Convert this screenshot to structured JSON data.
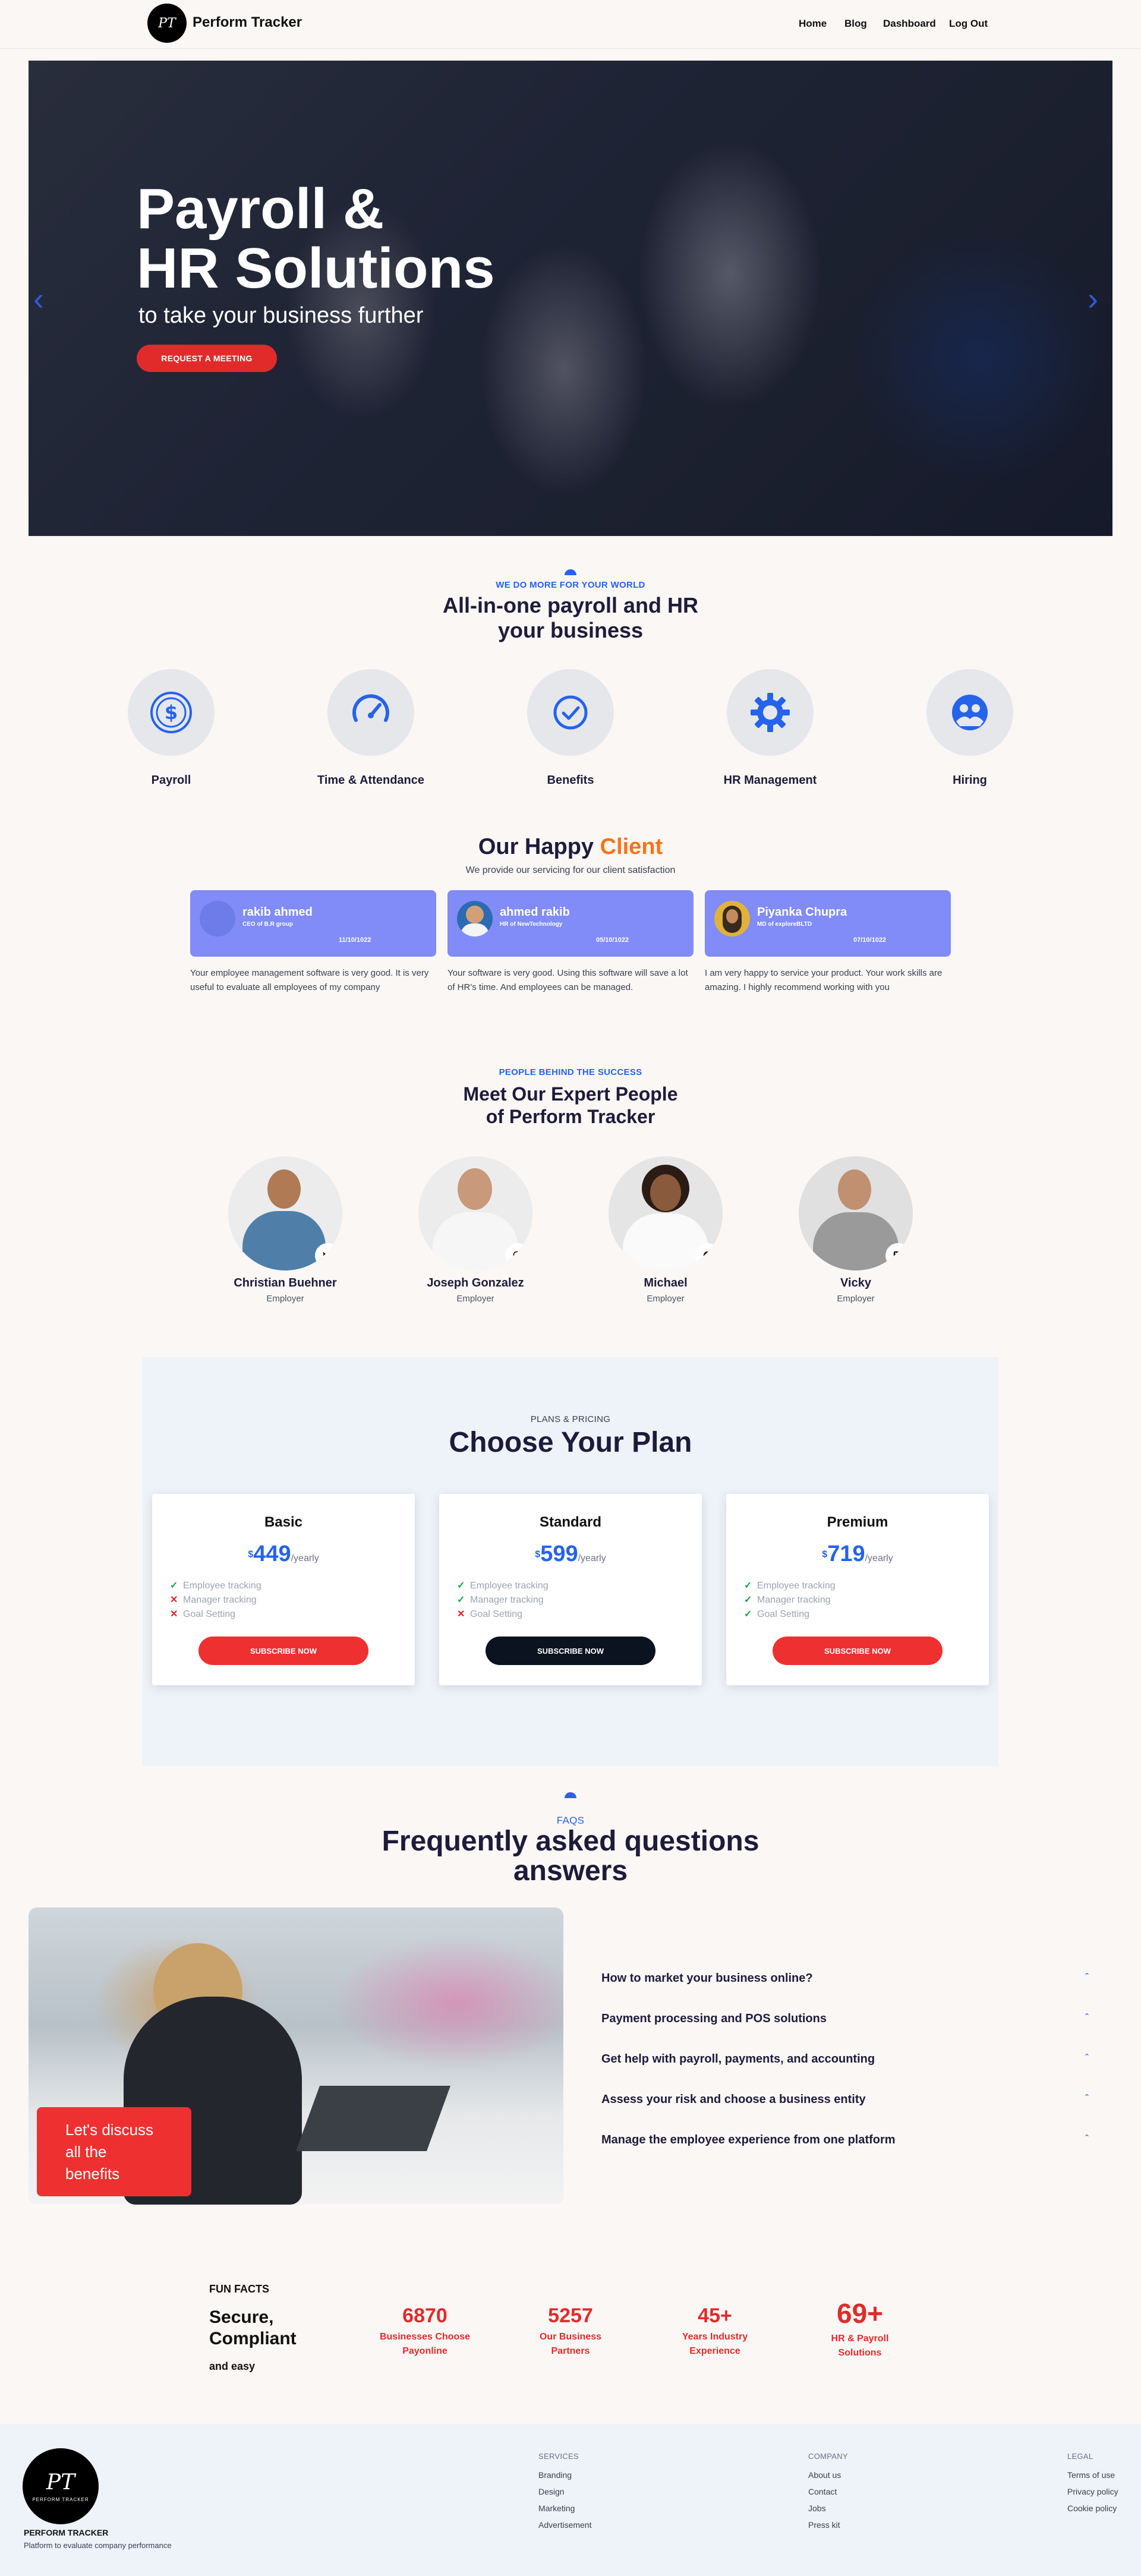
{
  "nav": {
    "logo_text": "PT",
    "brand": "Perform Tracker",
    "links": [
      "Home",
      "Blog",
      "Dashboard",
      "Log Out"
    ]
  },
  "hero": {
    "title_line1": "Payroll &",
    "title_line2": "HR Solutions",
    "subtitle": "to take your business further",
    "cta": "REQUEST A MEETING",
    "prev_icon": "chevron-left-icon",
    "next_icon": "chevron-right-icon"
  },
  "services": {
    "kicker": "WE DO MORE FOR YOUR WORLD",
    "title_line1": "All-in-one payroll and HR",
    "title_line2": "your business",
    "items": [
      {
        "label": "Payroll",
        "icon": "dollar-icon"
      },
      {
        "label": "Time & Attendance",
        "icon": "speedometer-icon"
      },
      {
        "label": "Benefits",
        "icon": "check-circle-icon"
      },
      {
        "label": "HR Management",
        "icon": "gear-icon"
      },
      {
        "label": "Hiring",
        "icon": "people-icon"
      }
    ]
  },
  "clients": {
    "title_main": "Our Happy",
    "title_accent": "Client",
    "subtitle": "We provide our servicing for our client satisfaction",
    "accent_color": "#f97316",
    "cards": [
      {
        "name": "rakib ahmed",
        "role": "CEO of B.R group",
        "date": "11/10/1022",
        "text": "Your employee management software is very good. It is very useful to evaluate all employees of my company"
      },
      {
        "name": "ahmed rakib",
        "role": "HR of NewTechnology",
        "date": "05/10/1022",
        "text": "Your software is very good. Using this software will save a lot of HR's time. And employees can be managed."
      },
      {
        "name": "Piyanka Chupra",
        "role": "MD of exploreBLTD",
        "date": "07/10/1022",
        "text": "I am very happy to service your product. Your work skills are amazing. I highly recommend working with you"
      }
    ]
  },
  "team": {
    "kicker": "PEOPLE BEHIND THE SUCCESS",
    "title_line1": "Meet Our Expert People",
    "title_line2": "of Perform Tracker",
    "people": [
      {
        "name": "Christian Buehner",
        "role": "Employer",
        "social": "twitter-icon"
      },
      {
        "name": "Joseph Gonzalez",
        "role": "Employer",
        "social": "instagram-icon"
      },
      {
        "name": "Michael",
        "role": "Employer",
        "social": "facebook-icon"
      },
      {
        "name": "Vicky",
        "role": "Employer",
        "social": "linkedin-icon"
      }
    ]
  },
  "pricing": {
    "kicker": "PLANS & PRICING",
    "title": "Choose Your Plan",
    "currency": "$",
    "period": "/yearly",
    "plans": [
      {
        "name": "Basic",
        "price": "449",
        "button": "SUBSCRIBE NOW",
        "button_color": "#ef3030",
        "features": [
          {
            "label": "Employee tracking",
            "included": true
          },
          {
            "label": "Manager tracking",
            "included": false
          },
          {
            "label": "Goal Setting",
            "included": false
          }
        ]
      },
      {
        "name": "Standard",
        "price": "599",
        "button": "SUBSCRIBE NOW",
        "button_color": "#0b1220",
        "features": [
          {
            "label": "Employee tracking",
            "included": true
          },
          {
            "label": "Manager tracking",
            "included": true
          },
          {
            "label": "Goal Setting",
            "included": false
          }
        ]
      },
      {
        "name": "Premium",
        "price": "719",
        "button": "SUBSCRIBE NOW",
        "button_color": "#ef3030",
        "features": [
          {
            "label": "Employee tracking",
            "included": true
          },
          {
            "label": "Manager tracking",
            "included": true
          },
          {
            "label": "Goal Setting",
            "included": true
          }
        ]
      }
    ]
  },
  "faq": {
    "kicker": "FAQS",
    "title_line1": "Frequently asked questions",
    "title_line2": "answers",
    "cta_line1": "Let's discuss",
    "cta_line2": "all the",
    "cta_line3": "benefits",
    "questions": [
      "How to market your business online?",
      "Payment processing and POS solutions",
      "Get help with payroll, payments, and accounting",
      "Assess your risk and choose a business entity",
      "Manage the employee experience from one platform"
    ]
  },
  "fun_facts": {
    "kicker": "FUN FACTS",
    "title_line1": "Secure,",
    "title_line2": "Compliant",
    "title_line3": "and easy",
    "stats": [
      {
        "num": "6870",
        "l1": "Businesses Choose",
        "l2": "Payonline"
      },
      {
        "num": "5257",
        "l1": "Our Business",
        "l2": "Partners"
      },
      {
        "num": "45+",
        "l1": "Years Industry",
        "l2": "Experience"
      },
      {
        "num": "69+",
        "l1": "HR & Payroll",
        "l2": "Solutions"
      }
    ]
  },
  "footer": {
    "logo_text": "PT",
    "logo_caption": "PERFORM TRACKER",
    "brand": "PERFORM TRACKER",
    "tagline": "Platform to evaluate company performance",
    "services": {
      "head": "SERVICES",
      "links": [
        "Branding",
        "Design",
        "Marketing",
        "Advertisement"
      ]
    },
    "company": {
      "head": "COMPANY",
      "links": [
        "About us",
        "Contact",
        "Jobs",
        "Press kit"
      ]
    },
    "legal": {
      "head": "LEGAL",
      "links": [
        "Terms of use",
        "Privacy policy",
        "Cookie policy"
      ]
    }
  }
}
